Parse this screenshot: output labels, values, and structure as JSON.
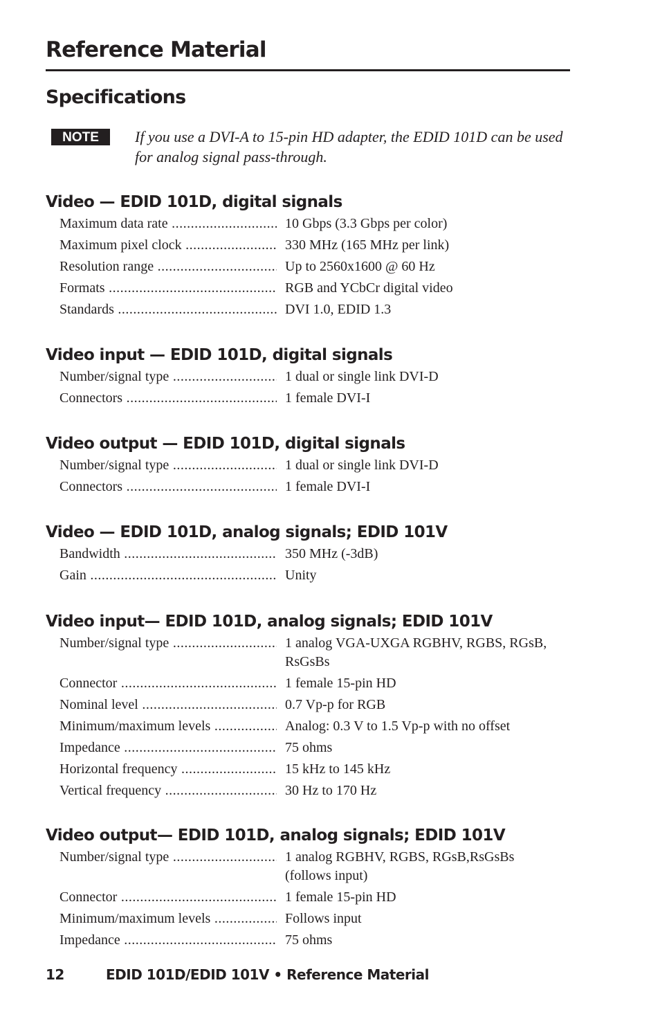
{
  "header": {
    "title": "Reference Material",
    "subtitle": "Specifications"
  },
  "note": {
    "badge": "NOTE",
    "text": "If you use a DVI-A to 15-pin HD adapter, the EDID 101D can be used for analog signal pass-through."
  },
  "sections": [
    {
      "title": "Video — EDID 101D, digital signals",
      "rows": [
        {
          "label": "Maximum data rate",
          "value": "10 Gbps (3.3 Gbps per color)"
        },
        {
          "label": "Maximum pixel clock",
          "value": "330 MHz (165 MHz per link)"
        },
        {
          "label": "Resolution range",
          "value": "Up to 2560x1600 @ 60 Hz"
        },
        {
          "label": "Formats",
          "value": "RGB and YCbCr digital video"
        },
        {
          "label": "Standards",
          "value": "DVI 1.0, EDID 1.3"
        }
      ]
    },
    {
      "title": "Video input — EDID 101D, digital signals",
      "rows": [
        {
          "label": "Number/signal type",
          "value": "1 dual or single link DVI-D"
        },
        {
          "label": "Connectors",
          "value": "1 female DVI-I"
        }
      ]
    },
    {
      "title": "Video output — EDID 101D, digital signals",
      "rows": [
        {
          "label": "Number/signal type",
          "value": "1 dual or single link DVI-D"
        },
        {
          "label": "Connectors",
          "value": "1 female DVI-I"
        }
      ]
    },
    {
      "title": "Video — EDID 101D, analog signals; EDID 101V",
      "rows": [
        {
          "label": "Bandwidth",
          "value": "350 MHz (-3dB)"
        },
        {
          "label": "Gain",
          "value": "Unity"
        }
      ]
    },
    {
      "title": "Video input— EDID 101D, analog signals; EDID 101V",
      "rows": [
        {
          "label": "Number/signal type",
          "value": "1 analog VGA-UXGA RGBHV, RGBS, RGsB, RsGsBs"
        },
        {
          "label": "Connector",
          "value": "1 female 15-pin HD"
        },
        {
          "label": "Nominal level",
          "value": "0.7 Vp-p for RGB"
        },
        {
          "label": "Minimum/maximum levels",
          "value": "Analog: 0.3 V to 1.5 Vp-p with no offset"
        },
        {
          "label": "Impedance",
          "value": "75 ohms"
        },
        {
          "label": "Horizontal frequency",
          "value": "15 kHz to 145 kHz"
        },
        {
          "label": "Vertical frequency",
          "value": "30 Hz to 170 Hz"
        }
      ]
    },
    {
      "title": "Video output— EDID 101D, analog signals; EDID 101V",
      "rows": [
        {
          "label": "Number/signal type",
          "value": "1 analog RGBHV, RGBS, RGsB,RsGsBs (follows input)"
        },
        {
          "label": "Connector",
          "value": "1 female 15-pin HD"
        },
        {
          "label": "Minimum/maximum levels",
          "value": "Follows input"
        },
        {
          "label": "Impedance",
          "value": "75 ohms"
        }
      ]
    }
  ],
  "footer": {
    "page_number": "12",
    "running_title": "EDID 101D/EDID 101V • Reference Material"
  }
}
